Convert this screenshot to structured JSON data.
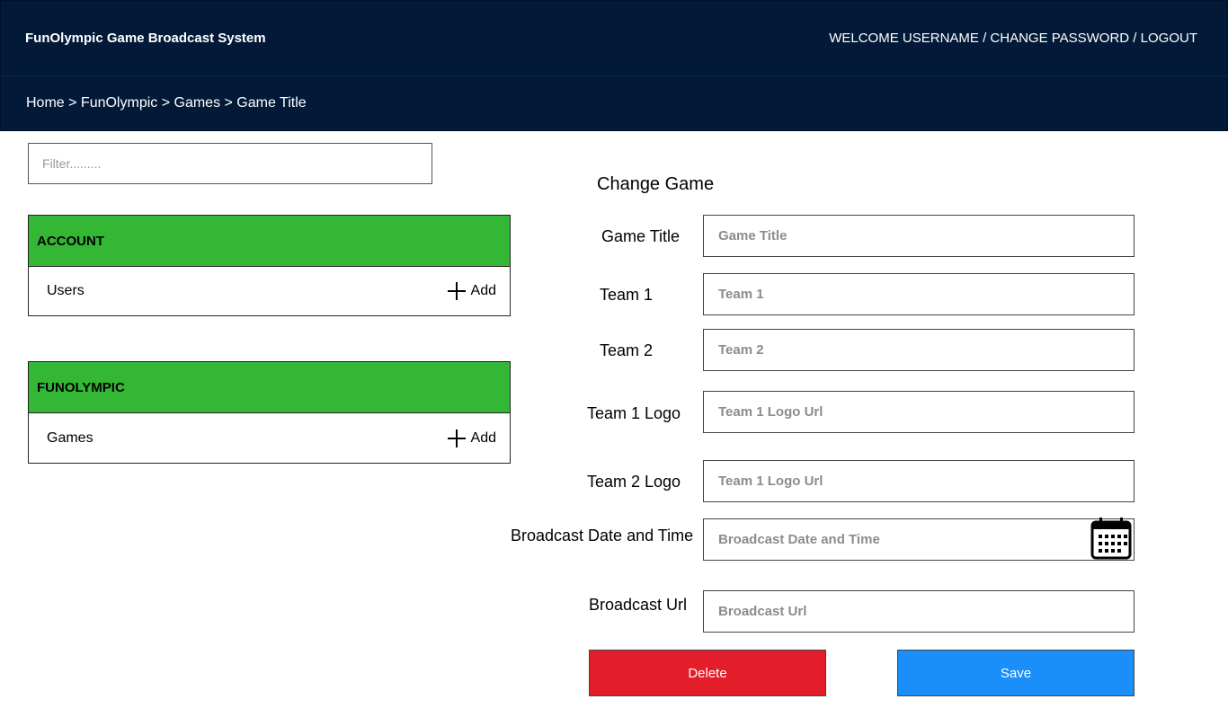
{
  "header": {
    "app_title": "FunOlympic Game Broadcast System",
    "user_links": "WELCOME USERNAME / CHANGE PASSWORD / LOGOUT"
  },
  "breadcrumb": "Home > FunOlympic > Games > Game Title",
  "sidebar": {
    "filter_placeholder": "Filter.........",
    "sections": [
      {
        "title": "ACCOUNT",
        "item": "Users",
        "add_label": "Add"
      },
      {
        "title": "FUNOLYMPIC",
        "item": "Games",
        "add_label": "Add"
      }
    ]
  },
  "form": {
    "title": "Change Game",
    "fields": {
      "game_title": {
        "label": "Game Title",
        "placeholder": "Game Title"
      },
      "team1": {
        "label": "Team 1",
        "placeholder": "Team 1"
      },
      "team2": {
        "label": "Team 2",
        "placeholder": "Team 2"
      },
      "team1_logo": {
        "label": "Team 1 Logo",
        "placeholder": "Team 1 Logo Url"
      },
      "team2_logo": {
        "label": "Team 2 Logo",
        "placeholder": "Team 1 Logo Url"
      },
      "broadcast_datetime": {
        "label": "Broadcast Date and Time",
        "placeholder": "Broadcast Date and Time",
        "icon": "calendar-icon"
      },
      "broadcast_url": {
        "label": "Broadcast Url",
        "placeholder": "Broadcast Url"
      }
    },
    "delete_label": "Delete",
    "save_label": "Save"
  },
  "colors": {
    "header_bg": "#021a38",
    "section_header": "#34b735",
    "delete_button": "#e31e2a",
    "save_button": "#1a8ef9"
  }
}
